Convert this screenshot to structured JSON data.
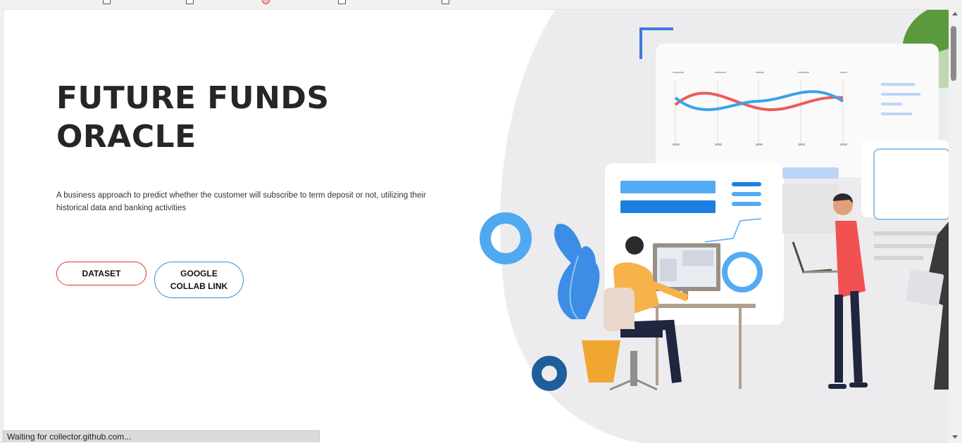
{
  "hero": {
    "title_line1": "FUTURE FUNDS",
    "title_line2": "ORACLE",
    "description": "A business approach to predict whether the customer will subscribe to term deposit or not, utilizing their historical data and banking activities"
  },
  "buttons": {
    "dataset": "DATASET",
    "collab": "GOOGLE COLLAB LINK"
  },
  "status_bar": {
    "text": "Waiting for collector.github.com..."
  },
  "colors": {
    "dataset_border": "#e03535",
    "collab_border": "#2f8fd8",
    "title": "#262626",
    "illustration_blob": "#ececee"
  },
  "icons": [
    "bookmark-icon",
    "illustration-team-analytics"
  ]
}
